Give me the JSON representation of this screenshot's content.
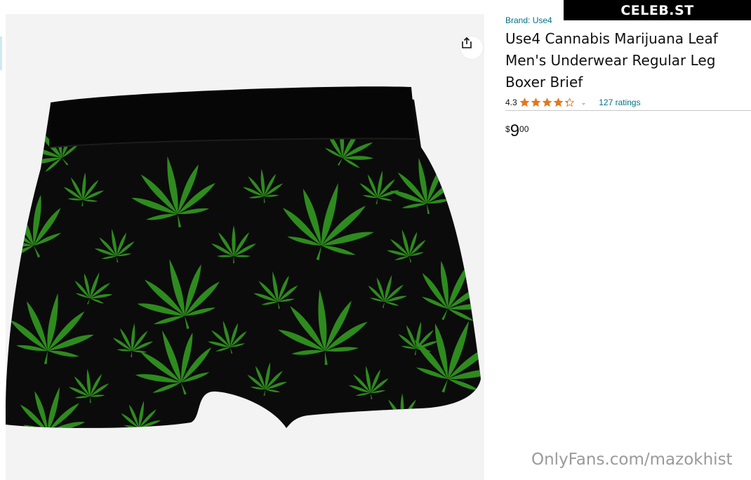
{
  "brand": {
    "label": "Brand: Use4"
  },
  "product": {
    "title": "Use4 Cannabis Marijuana Leaf Men's Underwear Regular Leg Boxer Brief",
    "rating_value": "4.3",
    "rating_stars": 4.3,
    "ratings_count": "127 ratings",
    "price": {
      "currency": "$",
      "whole": "9",
      "fraction": "00"
    }
  },
  "image": {
    "description_icon": "boxer-brief-product-photo"
  },
  "icons": {
    "share": "share-icon",
    "chevron": "chevron-down-icon",
    "star": "star-icon"
  },
  "watermark": {
    "badge": "CELEB.ST",
    "text": "OnlyFans.com/mazokhist"
  },
  "colors": {
    "link": "#007185",
    "star": "#de7921",
    "leaf": "#2e8b1e",
    "fabric": "#0a0a0a"
  }
}
